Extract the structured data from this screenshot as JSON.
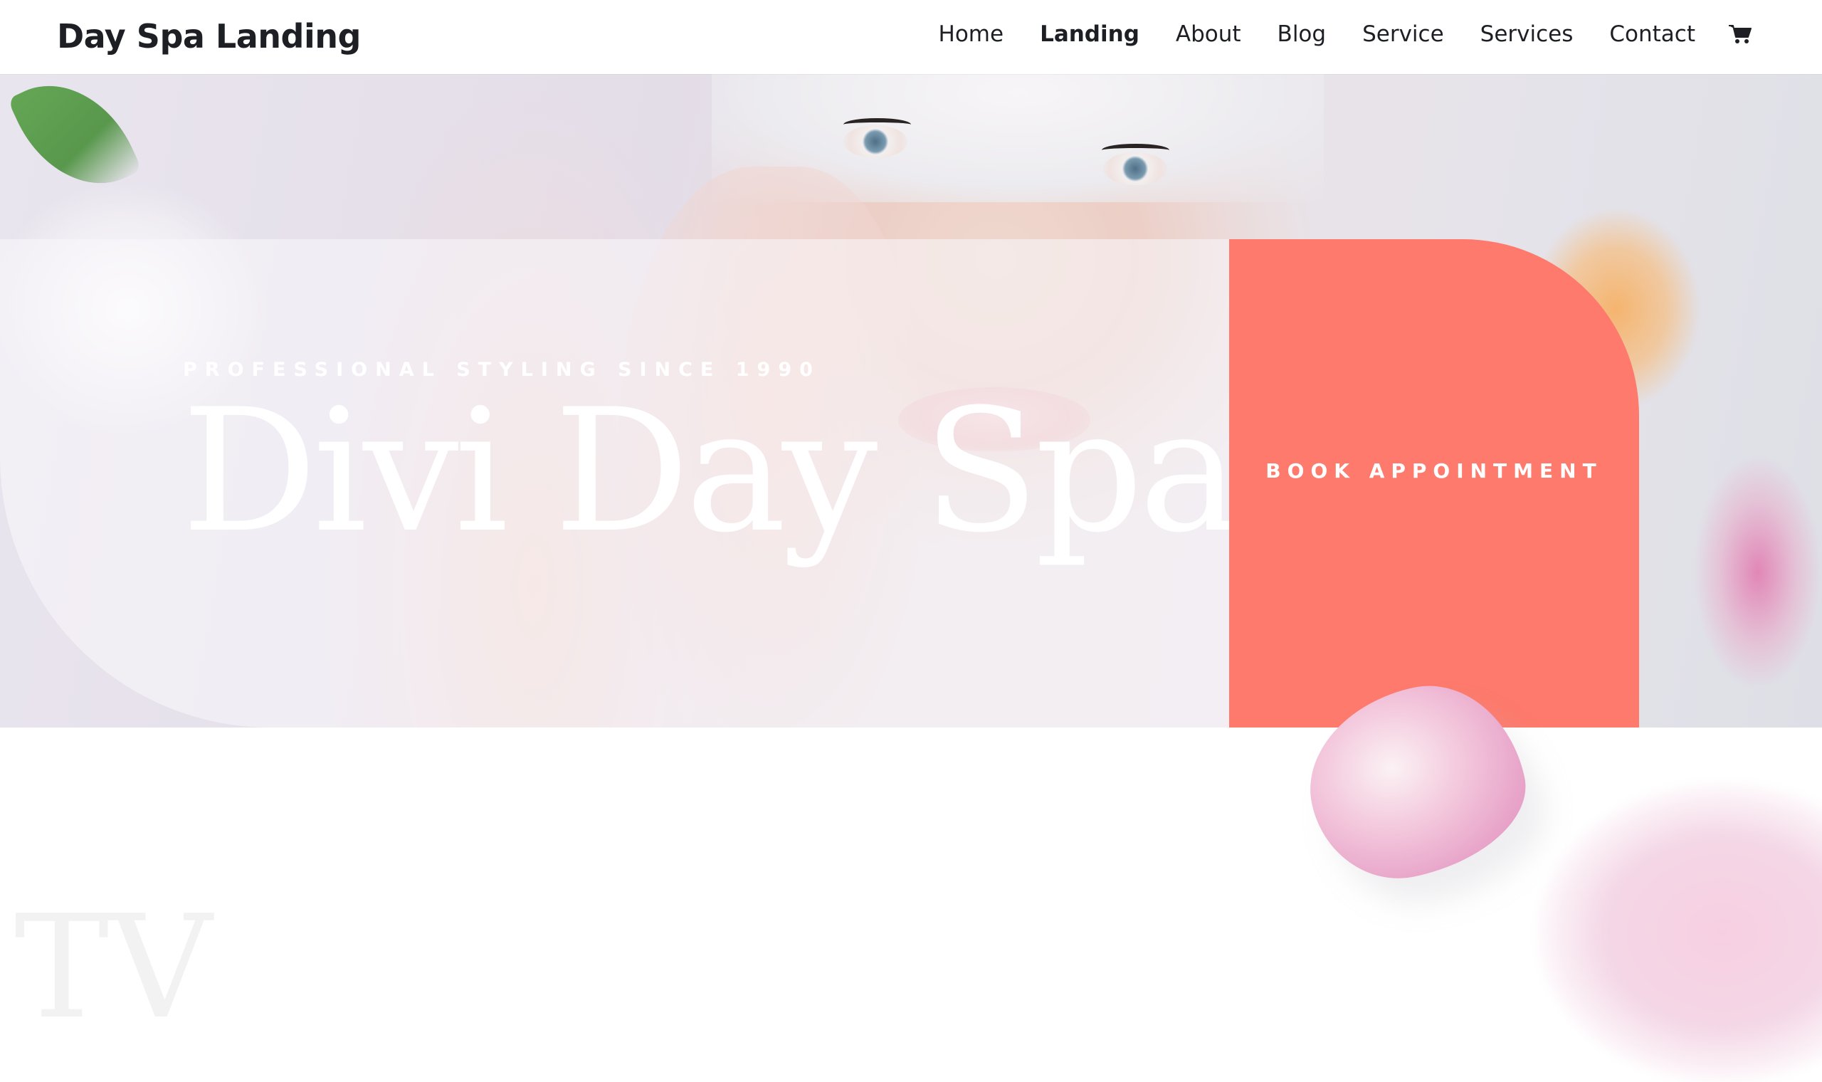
{
  "header": {
    "site_title": "Day Spa Landing",
    "nav": [
      {
        "label": "Home",
        "active": false
      },
      {
        "label": "Landing",
        "active": true
      },
      {
        "label": "About",
        "active": false
      },
      {
        "label": "Blog",
        "active": false
      },
      {
        "label": "Service",
        "active": false
      },
      {
        "label": "Services",
        "active": false
      },
      {
        "label": "Contact",
        "active": false
      }
    ],
    "cart_icon": "shopping-cart-icon"
  },
  "hero": {
    "eyebrow": "PROFESSIONAL STYLING SINCE 1990",
    "title": "Divi Day Spa",
    "cta_label": "BOOK APPOINTMENT"
  },
  "colors": {
    "accent": "#fd7a6c",
    "text_dark": "#1d1f24",
    "white": "#ffffff"
  }
}
